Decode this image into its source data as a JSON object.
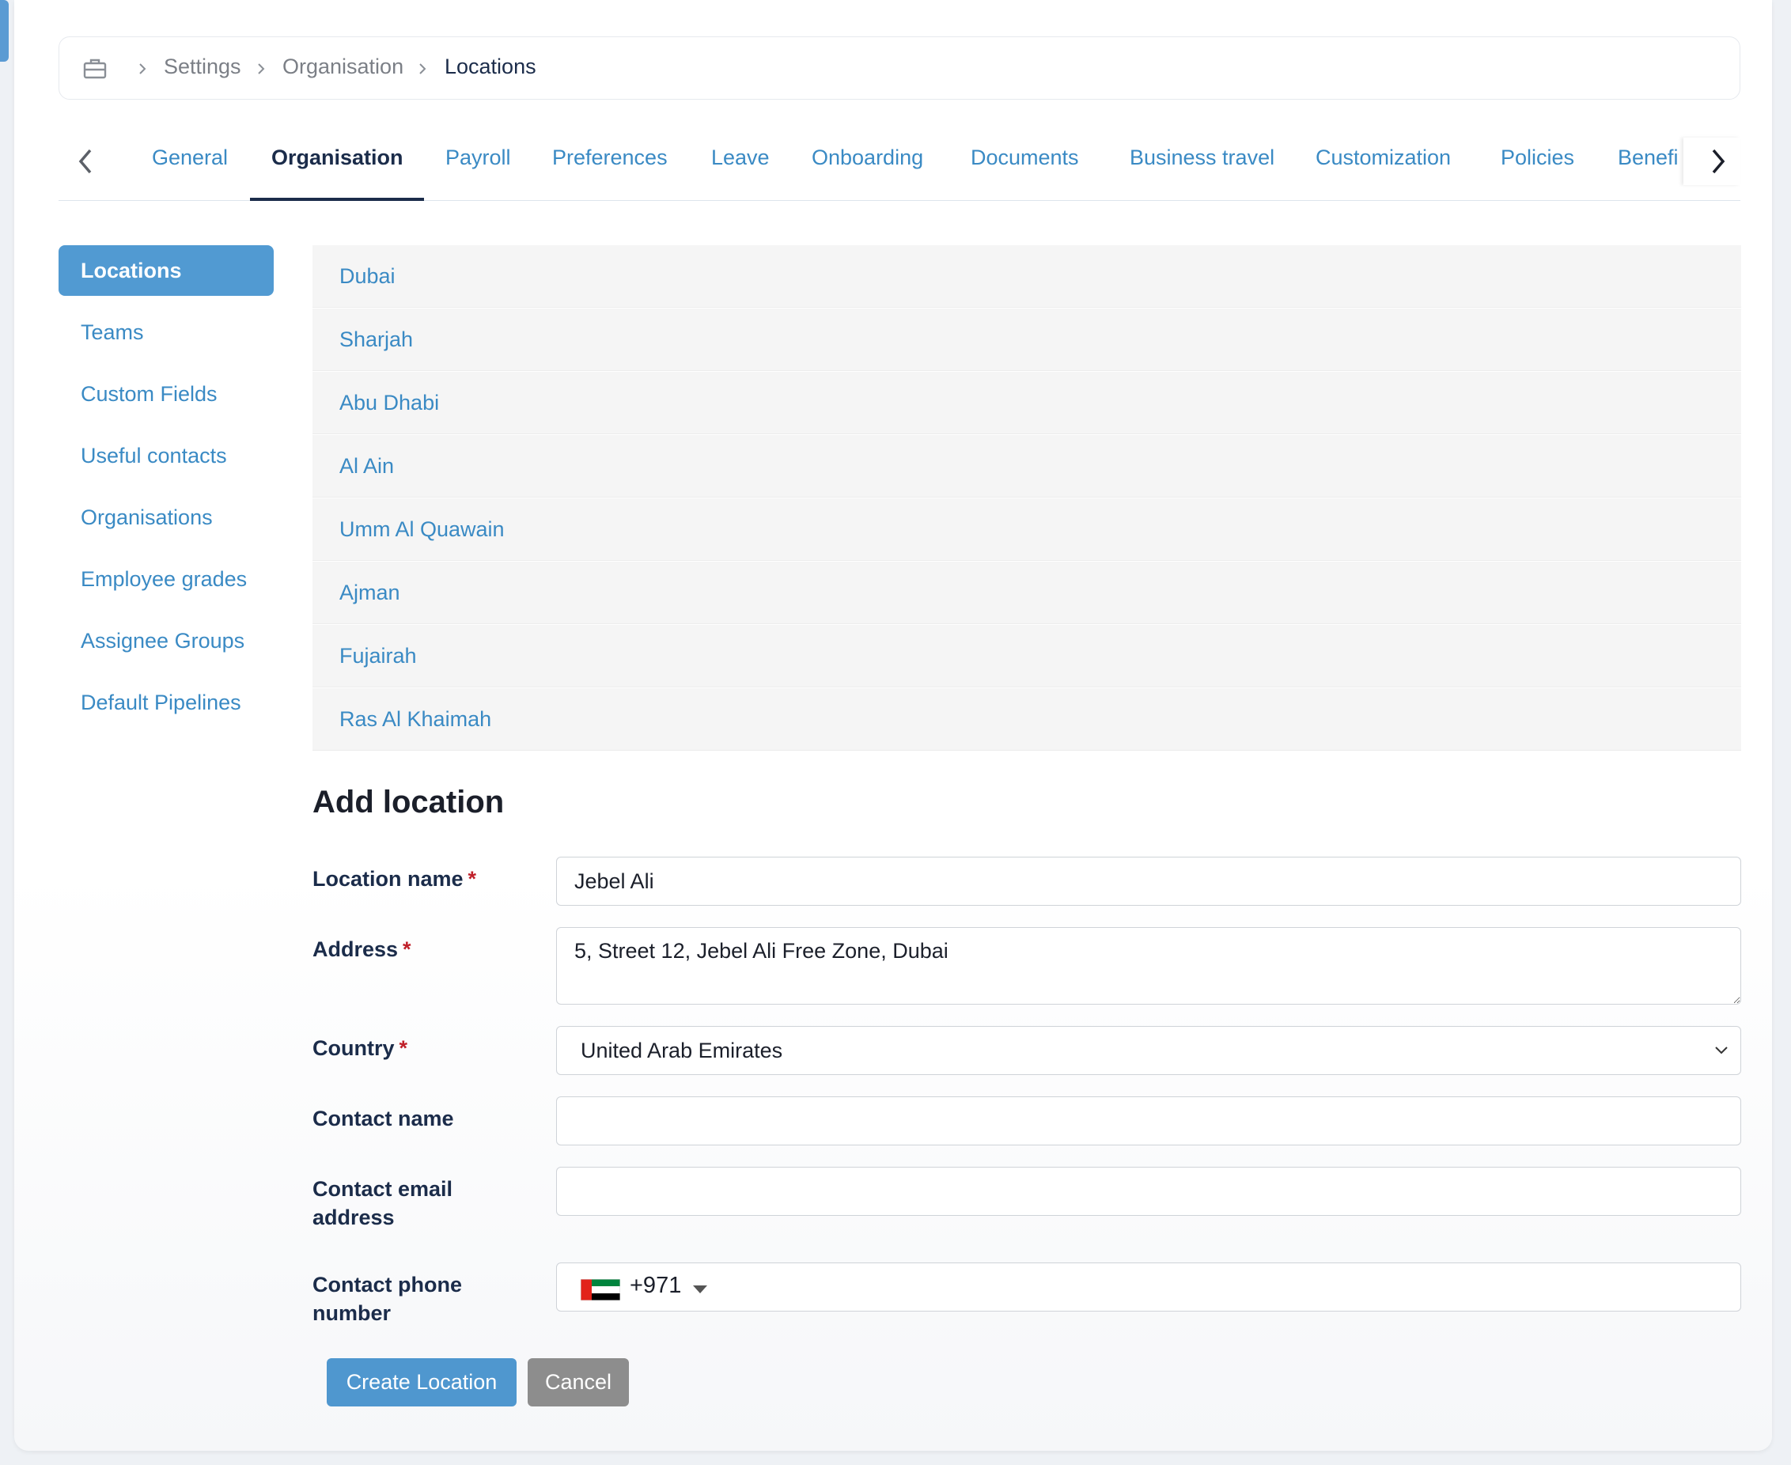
{
  "breadcrumb": {
    "icon": "briefcase-icon",
    "items": [
      "Settings",
      "Organisation",
      "Locations"
    ]
  },
  "tabs": [
    "General",
    "Organisation",
    "Payroll",
    "Preferences",
    "Leave",
    "Onboarding",
    "Documents",
    "Business travel",
    "Customization",
    "Policies",
    "Benefits"
  ],
  "active_tab": "Organisation",
  "side_nav": {
    "items": [
      "Locations",
      "Teams",
      "Custom Fields",
      "Useful contacts",
      "Organisations",
      "Employee grades",
      "Assignee Groups",
      "Default Pipelines"
    ],
    "active": "Locations"
  },
  "locations": [
    "Dubai",
    "Sharjah",
    "Abu Dhabi",
    "Al Ain",
    "Umm Al Quawain",
    "Ajman",
    "Fujairah",
    "Ras Al Khaimah"
  ],
  "form": {
    "title": "Add location",
    "location_name": {
      "label": "Location name",
      "required": "*",
      "value": "Jebel Ali"
    },
    "address": {
      "label": "Address",
      "required": "*",
      "value": "5, Street 12, Jebel Ali Free Zone, Dubai"
    },
    "country": {
      "label": "Country",
      "required": "*",
      "value": "United Arab Emirates"
    },
    "contact_name": {
      "label": "Contact name",
      "value": ""
    },
    "contact_email": {
      "label_line1": "Contact email",
      "label_line2": "address",
      "value": ""
    },
    "contact_phone": {
      "label_line1": "Contact phone",
      "label_line2": "number",
      "dial_code": "+971",
      "flag": "uae-flag-icon",
      "value": ""
    },
    "create_button": "Create Location",
    "cancel_button": "Cancel"
  },
  "colors": {
    "accent": "#4f97cf",
    "link": "#3a8ac4",
    "text_dark": "#1b2c4a",
    "required": "#c0202a",
    "cancel": "#8d8d8d"
  }
}
